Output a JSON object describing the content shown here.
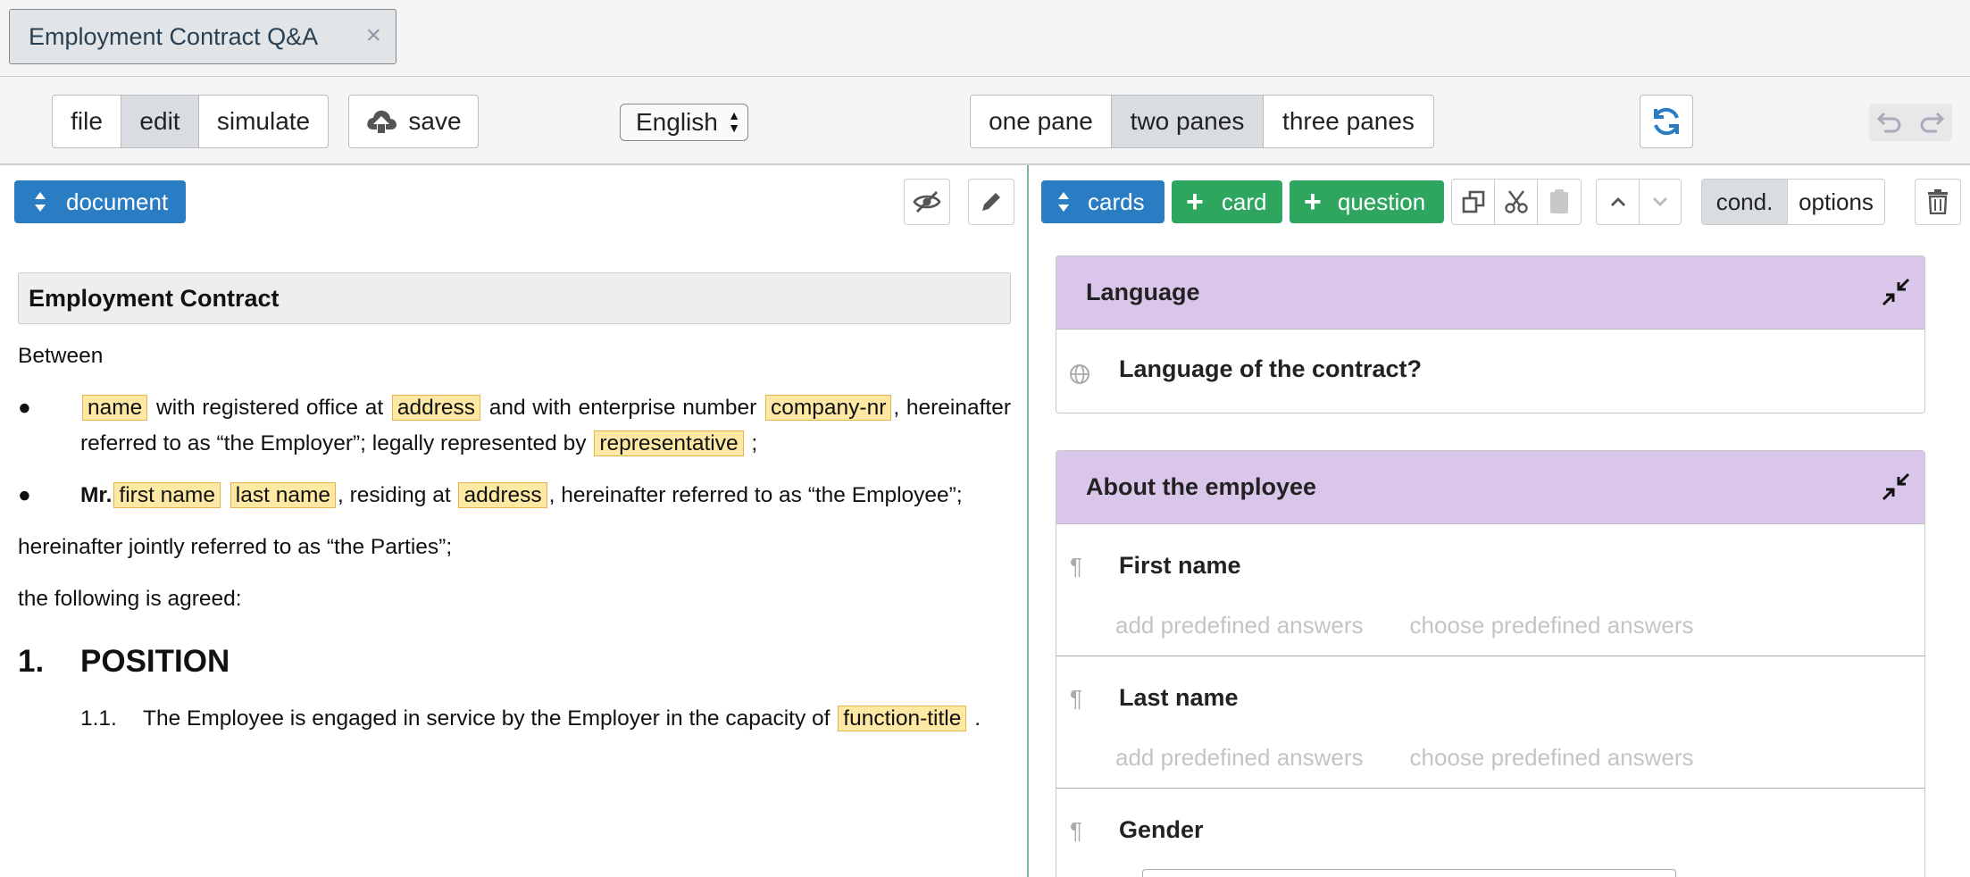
{
  "tab": {
    "title": "Employment Contract Q&A",
    "close": "×"
  },
  "toolbar": {
    "modes": [
      "file",
      "edit",
      "simulate"
    ],
    "active_mode": "edit",
    "save_label": "save",
    "language": "English",
    "panes": [
      "one pane",
      "two panes",
      "three panes"
    ],
    "active_pane": "two panes"
  },
  "left": {
    "document_btn": "document",
    "doc": {
      "title": "Employment Contract",
      "between": "Between",
      "bullet1": {
        "v_name": "name",
        "t1": "with registered office at",
        "v_address": "address",
        "t2": "and with enterprise number",
        "v_company": "company-nr",
        "t3": ", hereinafter referred to as “the Employer”; legally represented by",
        "v_rep": "representative",
        "t4": ";"
      },
      "bullet2": {
        "mr": "Mr.",
        "v_first": "first name",
        "v_last": "last name",
        "t1": ", residing at",
        "v_address": "address",
        "t2": ", hereinafter referred to as “the Employee”;"
      },
      "jointly": "hereinafter jointly referred to as “the Parties”;",
      "agreed": "the following is agreed:",
      "section_num": "1.",
      "section_title": "POSITION",
      "sub_num": "1.1.",
      "sub_text": "The Employee is engaged in service by the Employer in the capacity of",
      "v_function": "function-title",
      "sub_end": "."
    }
  },
  "right": {
    "cards_btn": "cards",
    "add_card": "card",
    "add_question": "question",
    "plus": "+",
    "cond": "cond.",
    "options": "options",
    "cards": [
      {
        "title": "Language",
        "questions": [
          {
            "icon": "globe-icon",
            "title": "Language of the contract?"
          }
        ]
      },
      {
        "title": "About the employee",
        "questions": [
          {
            "icon": "pilcrow-icon",
            "title": "First name",
            "add": "add predefined answers",
            "choose": "choose predefined answers"
          },
          {
            "icon": "pilcrow-icon",
            "title": "Last name",
            "add": "add predefined answers",
            "choose": "choose predefined answers"
          },
          {
            "icon": "pilcrow-icon",
            "title": "Gender"
          }
        ]
      }
    ],
    "pilcrow": "¶"
  }
}
